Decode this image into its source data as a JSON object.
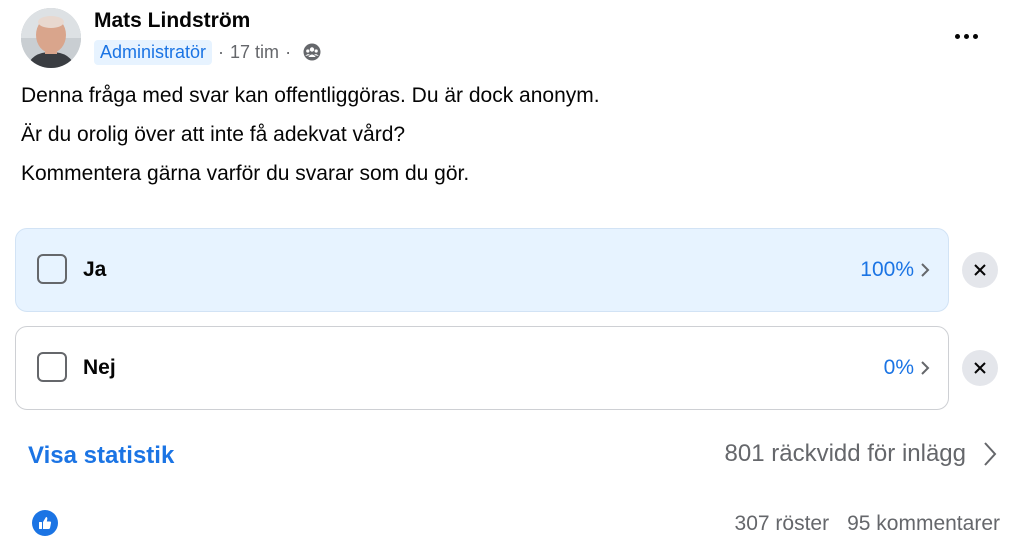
{
  "post": {
    "author": "Mats Lindström",
    "role": "Administratör",
    "time": "17 tim",
    "separator": "·",
    "audience_icon": "group-icon",
    "paragraphs": [
      "Denna fråga med svar kan offentliggöras. Du är dock anonym.",
      "Är du orolig över att inte få adekvat vård?",
      "Kommentera gärna varför du svarar som du gör."
    ]
  },
  "poll": {
    "options": [
      {
        "label": "Ja",
        "percent": "100%",
        "selected": true
      },
      {
        "label": "Nej",
        "percent": "0%",
        "selected": false
      }
    ]
  },
  "footer": {
    "stats_link": "Visa statistik",
    "reach": "801 räckvidd för inlägg",
    "votes": "307 röster",
    "comments": "95 kommentarer",
    "reaction_icon": "like-icon"
  },
  "colors": {
    "accent": "#1b74e4",
    "selected_bg": "#e7f3ff",
    "muted_text": "#65676b"
  }
}
